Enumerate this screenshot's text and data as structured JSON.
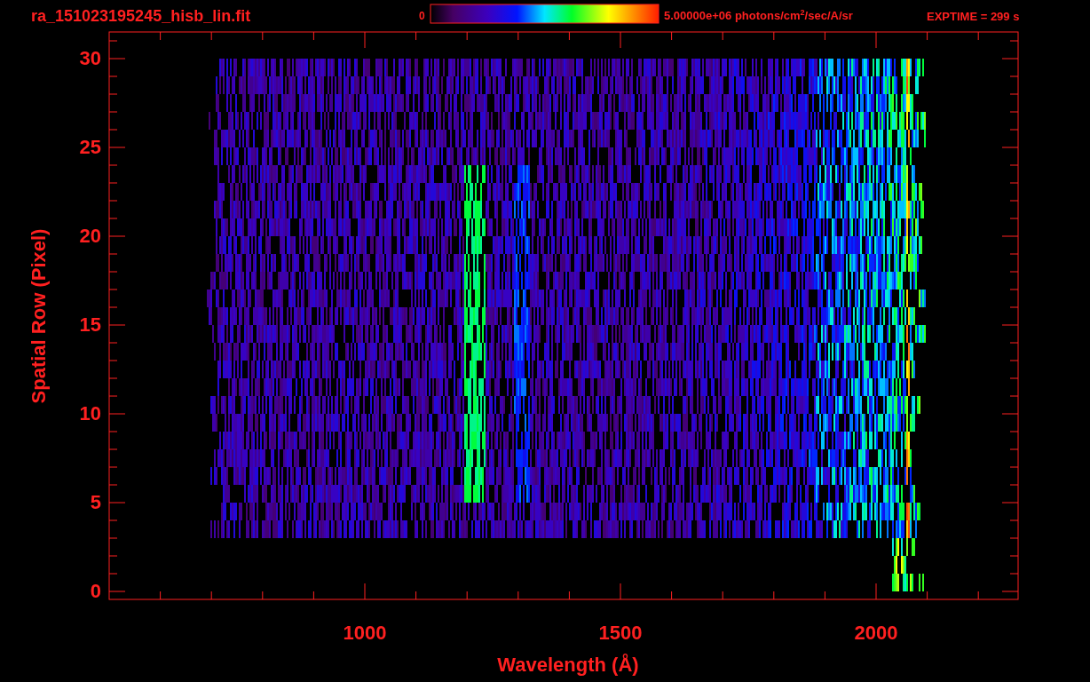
{
  "title": "ra_151023195245_hisb_lin.fit",
  "colorbar": {
    "min_label": "0",
    "max_label": "5.00000e+06 photons/cm$^{2}$/sec/A/sr"
  },
  "exposure": "EXPTIME = 299 s",
  "plot": {
    "xlabel": "Wavelength (Å)",
    "ylabel": "Spatial Row (Pixel)",
    "xtick_labels": [
      "1000",
      "1500",
      "2000"
    ],
    "ytick_labels": [
      "30",
      "25",
      "20",
      "15",
      "10",
      "5",
      "0"
    ]
  }
}
